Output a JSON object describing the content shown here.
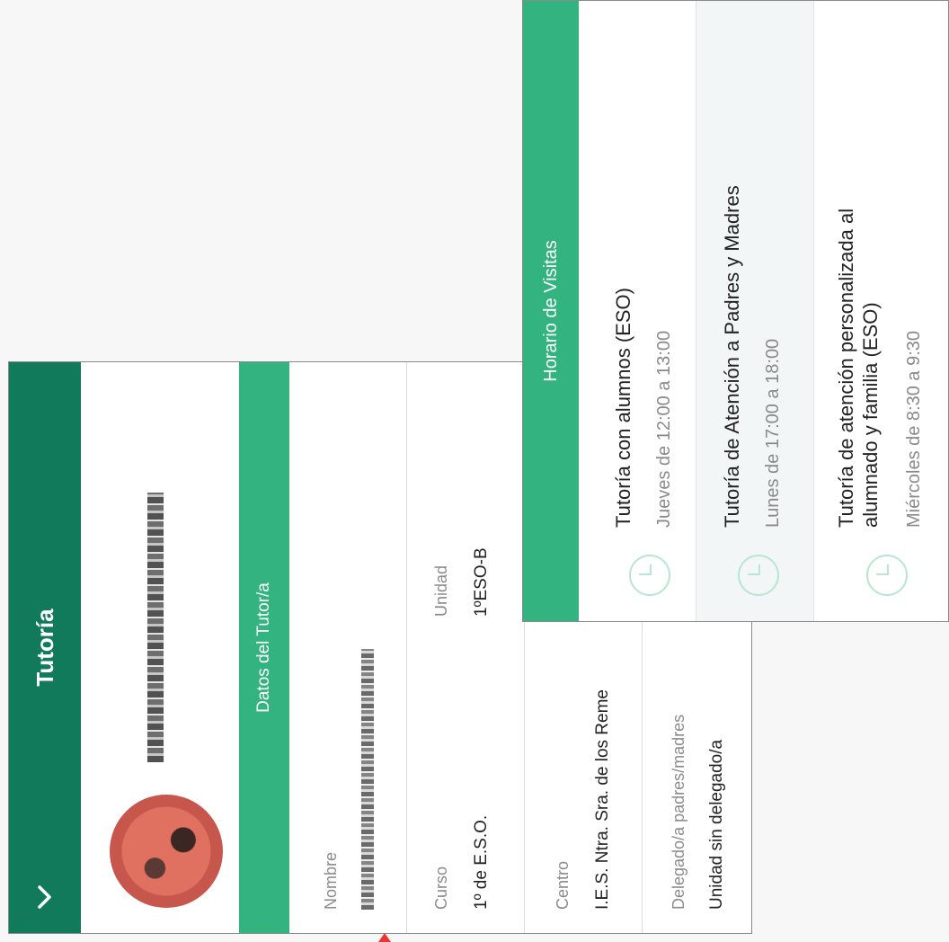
{
  "tutoria": {
    "header_title": "Tutoría",
    "section_title": "Datos del Tutor/a",
    "fields": {
      "nombre_label": "Nombre",
      "curso_label": "Curso",
      "curso_value": "1º de E.S.O.",
      "unidad_label": "Unidad",
      "unidad_value": "1ºESO-B",
      "centro_label": "Centro",
      "centro_value": "I.E.S. Ntra. Sra. de los Reme",
      "delegado_label": "Delegado/a padres/madres",
      "delegado_value": "Unidad sin delegado/a"
    },
    "icons": {
      "back": "chevron-down-icon",
      "avatar": "avatar"
    }
  },
  "horario": {
    "title": "Horario de Visitas",
    "items": [
      {
        "title": "Tutoría con alumnos (ESO)",
        "time": "Jueves de 12:00 a 13:00"
      },
      {
        "title": "Tutoría de Atención a Padres y Madres",
        "time": "Lunes de 17:00 a 18:00"
      },
      {
        "title": "Tutoría de atención personalizada al alumnado y familia (ESO)",
        "time": "Miércoles de 8:30 a 9:30"
      }
    ],
    "icon": "clock-icon"
  },
  "colors": {
    "header_green": "#107a5a",
    "accent_green": "#33b37f",
    "clock_green": "#b9e6d2"
  }
}
